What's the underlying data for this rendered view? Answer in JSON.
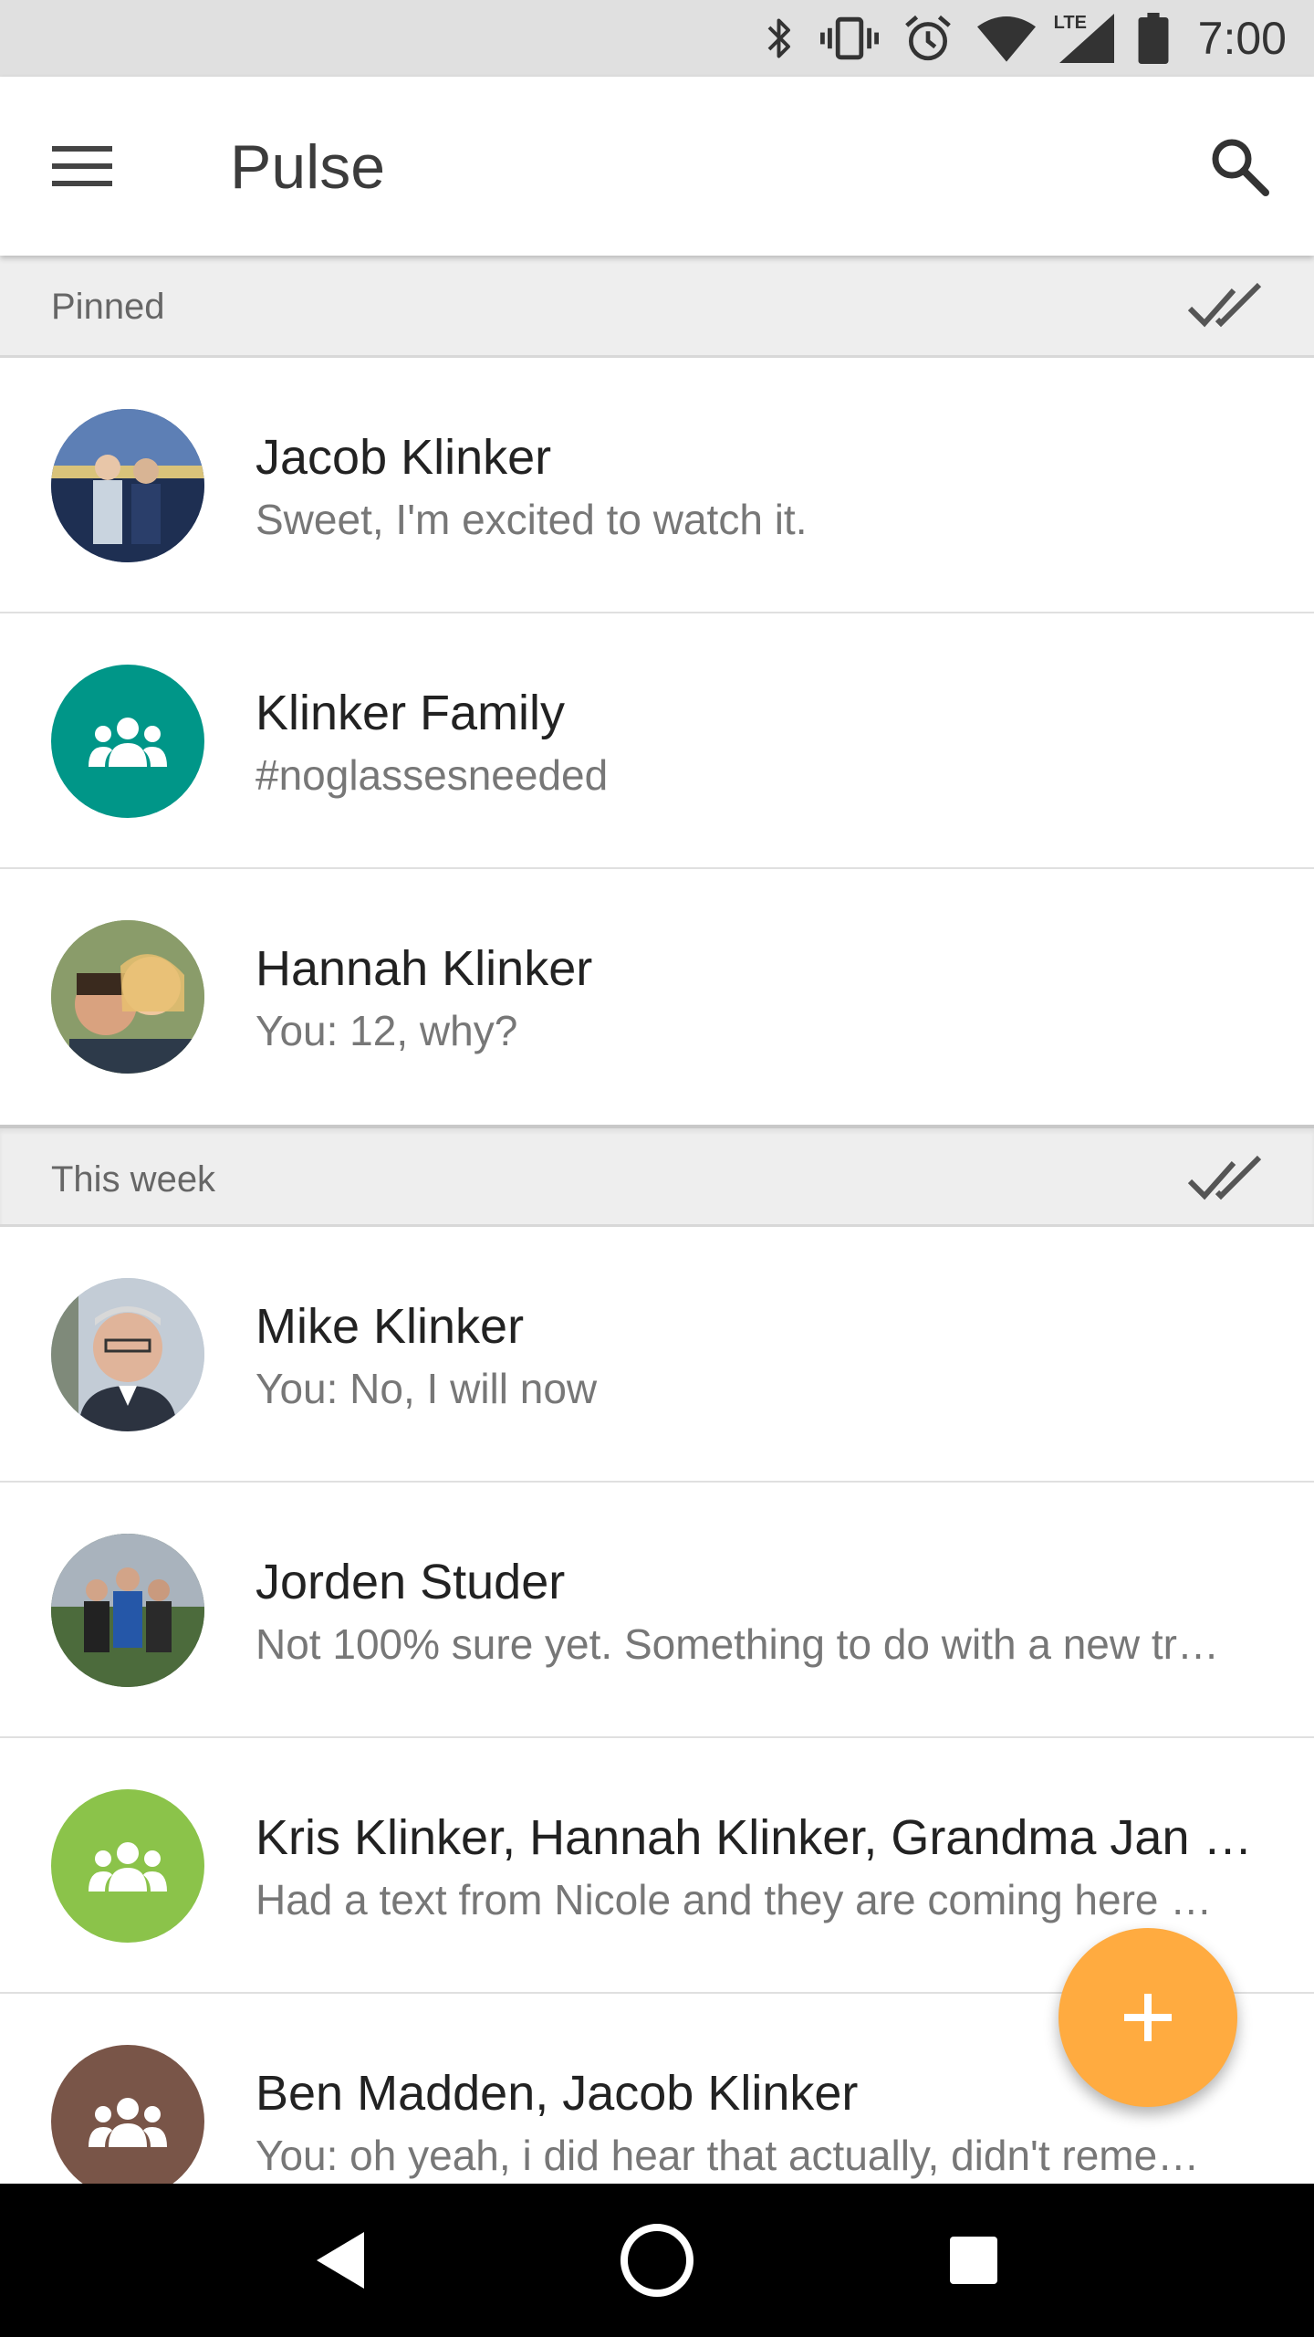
{
  "status_bar": {
    "time": "7:00",
    "icons": [
      "bluetooth-icon",
      "vibrate-icon",
      "alarm-icon",
      "wifi-icon",
      "lte-signal-icon",
      "battery-icon"
    ],
    "lte_label": "LTE"
  },
  "app_bar": {
    "title": "Pulse",
    "menu_icon": "hamburger-menu-icon",
    "search_icon": "search-icon"
  },
  "sections": [
    {
      "label": "Pinned",
      "conversations": [
        {
          "name": "Jacob Klinker",
          "preview": "Sweet, I'm excited to watch it.",
          "avatar": "photo",
          "avatar_color": "#3b5f8e"
        },
        {
          "name": "Klinker Family",
          "preview": "#noglassesneeded",
          "avatar": "group-icon",
          "avatar_color": "#009688"
        },
        {
          "name": "Hannah Klinker",
          "preview": "You: 12, why?",
          "avatar": "photo",
          "avatar_color": "#9a7a5a"
        }
      ]
    },
    {
      "label": "This week",
      "conversations": [
        {
          "name": "Mike Klinker",
          "preview": "You: No, I will now",
          "avatar": "photo",
          "avatar_color": "#8fa3b8"
        },
        {
          "name": "Jorden Studer",
          "preview": "Not 100% sure yet. Something to do with a new tr…",
          "avatar": "photo",
          "avatar_color": "#3f5a3a"
        },
        {
          "name": "Kris Klinker, Hannah Klinker, Grandma Jan …",
          "preview": "Had a text from Nicole and they are coming here …",
          "avatar": "group-icon",
          "avatar_color": "#8bc34a"
        },
        {
          "name": "Ben Madden, Jacob Klinker",
          "preview": "You: oh yeah, i did hear that actually, didn't reme…",
          "avatar": "group-icon",
          "avatar_color": "#795548"
        }
      ]
    }
  ],
  "fab": {
    "icon": "plus-icon",
    "color": "#ffab40"
  },
  "nav_bar": {
    "icons": [
      "back-icon",
      "home-icon",
      "recents-icon"
    ]
  },
  "colors": {
    "status_bar": "#e0e0e0",
    "section_header": "#eeeeee",
    "accent": "#ffab40"
  }
}
